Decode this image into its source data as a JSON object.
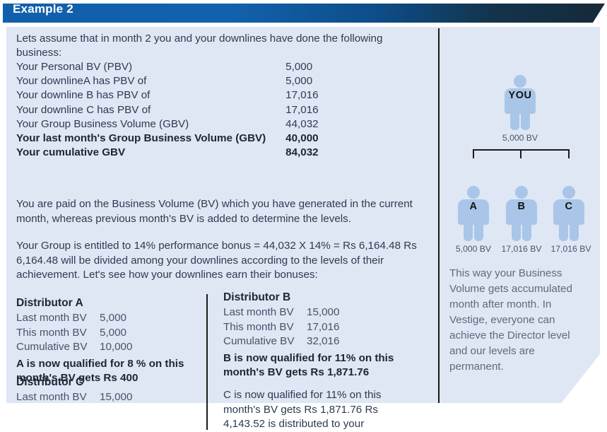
{
  "header": {
    "title": "Example 2"
  },
  "main": {
    "intro": "Lets assume that in month 2 you and your downlines have done the following business:",
    "bv_rows": [
      {
        "label": "Your Personal BV (PBV)",
        "value": "5,000",
        "bold": false
      },
      {
        "label": "Your downlineA has PBV of",
        "value": "5,000",
        "bold": false
      },
      {
        "label": "Your downline B has PBV of",
        "value": "17,016",
        "bold": false
      },
      {
        "label": "Your downline C has PBV of",
        "value": "17,016",
        "bold": false
      },
      {
        "label": "Your Group Business Volume (GBV)",
        "value": "44,032",
        "bold": false
      },
      {
        "label": "Your last month's Group Business Volume (GBV)",
        "value": "40,000",
        "bold": true
      },
      {
        "label": "Your cumulative GBV",
        "value": "84,032",
        "bold": true
      }
    ],
    "para_paid": "You are paid on the Business Volume (BV) which you have generated in the current month, whereas previous month's BV is added to determine the levels.",
    "para_bonus": "Your Group is entitled to 14% performance bonus = 44,032 X 14% = Rs 6,164.48 Rs 6,164.48 will be divided among your downlines according to the levels of their achievement. Let's see how your downlines earn their bonuses:",
    "distributor_a": {
      "heading": "Distributor A",
      "rows": [
        {
          "label": "Last month BV",
          "value": "5,000"
        },
        {
          "label": "This month BV",
          "value": "5,000"
        },
        {
          "label": "Cumulative BV",
          "value": "10,000"
        }
      ],
      "note": "A is now qualified for 8 % on this month's BV gets Rs 400"
    },
    "distributor_c": {
      "heading": "Distributor C",
      "rows": [
        {
          "label": "Last month BV",
          "value": "15,000"
        }
      ]
    },
    "distributor_b": {
      "heading": "Distributor B",
      "rows": [
        {
          "label": "Last month BV",
          "value": "15,000"
        },
        {
          "label": "This month BV",
          "value": "17,016"
        },
        {
          "label": "Cumulative BV",
          "value": "32,016"
        }
      ],
      "note": "B is now qualified for 11% on this month's BV gets Rs 1,871.76",
      "note_c": "C is now qualified for 11% on this month's BV gets Rs 1,871.76 Rs 4,143.52 is distributed to your"
    }
  },
  "sidebar": {
    "you": {
      "label": "YOU",
      "caption": "5,000 BV"
    },
    "downlines": [
      {
        "label": "A",
        "caption": "5,000 BV"
      },
      {
        "label": "B",
        "caption": "17,016 BV"
      },
      {
        "label": "C",
        "caption": "17,016 BV"
      }
    ],
    "note": "This way your Business Volume gets accumulated month after month. In Vestige, everyone can achieve the Director level and our levels are permanent."
  },
  "colors": {
    "header_start": "#1260ab",
    "header_end": "#152a3a",
    "panel_bg": "#dfe6f4",
    "figure_fill": "#a9c6e8",
    "body_text": "#2d3b52"
  }
}
